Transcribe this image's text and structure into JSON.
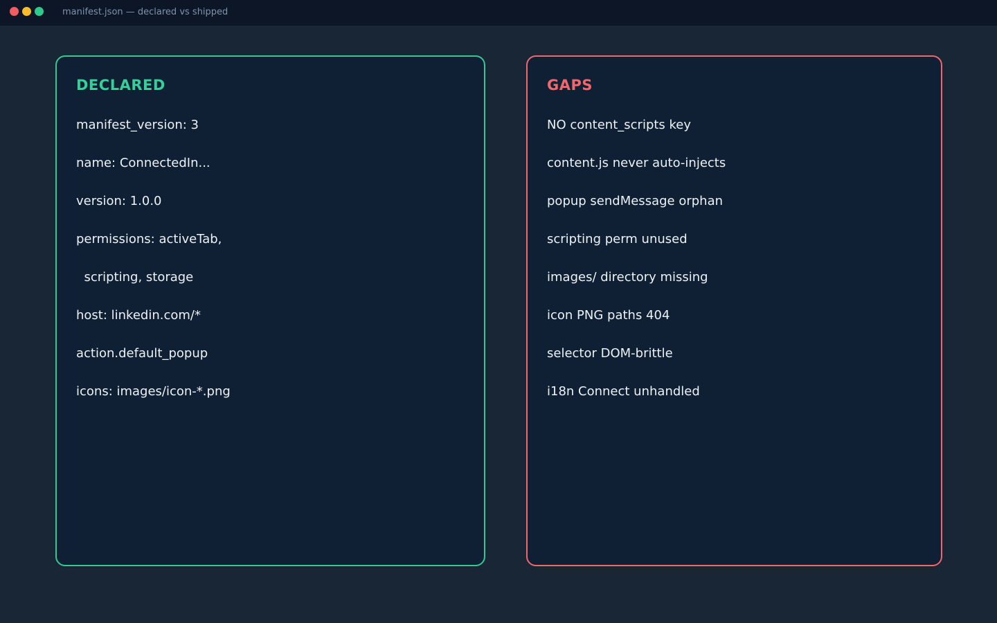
{
  "window": {
    "title": "manifest.json — declared vs shipped",
    "controls": [
      {
        "name": "close",
        "color": "#f05b64"
      },
      {
        "name": "minimize",
        "color": "#f7bd2b"
      },
      {
        "name": "maximize",
        "color": "#2fc98c"
      }
    ]
  },
  "declared": {
    "heading": "DECLARED",
    "accent": "#35cf9a",
    "lines": [
      "manifest_version: 3",
      "name: ConnectedIn...",
      "version: 1.0.0",
      "permissions: activeTab,",
      "  scripting, storage",
      "host: linkedin.com/*",
      "action.default_popup",
      "icons: images/icon-*.png"
    ]
  },
  "gaps": {
    "heading": "GAPS",
    "accent": "#f0676d",
    "lines": [
      "NO content_scripts key",
      "content.js never auto-injects",
      "popup sendMessage orphan",
      "scripting perm unused",
      "images/ directory missing",
      "icon PNG paths 404",
      "selector DOM-brittle",
      "i18n Connect unhandled"
    ]
  }
}
